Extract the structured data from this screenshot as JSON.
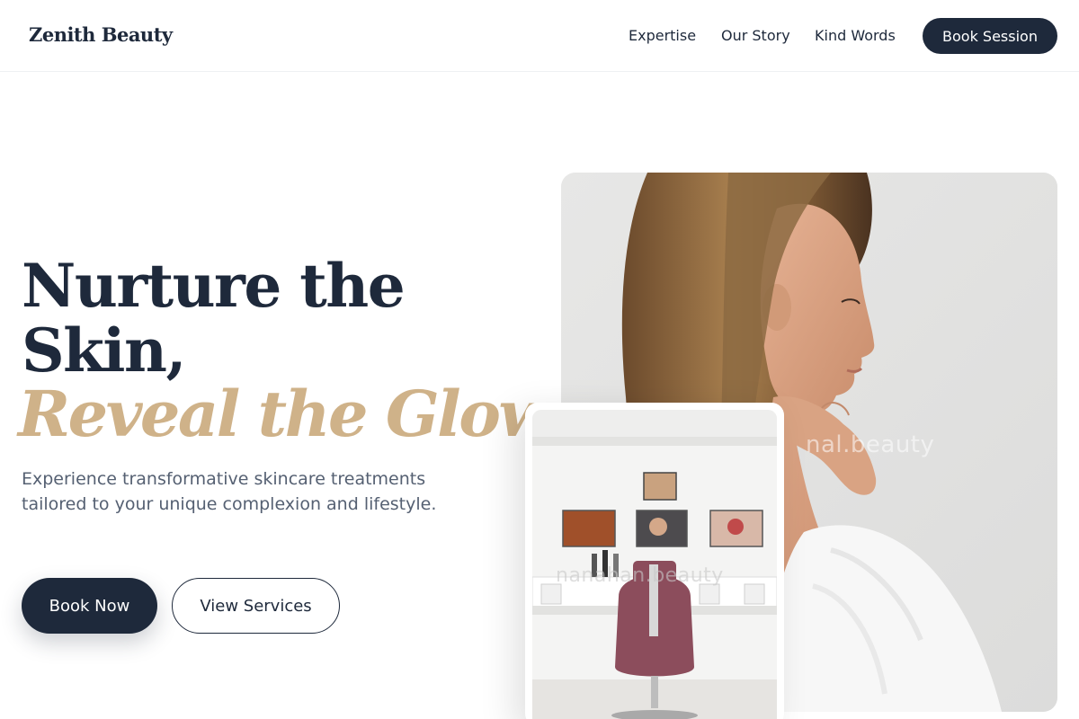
{
  "nav": {
    "brand": "Zenith Beauty",
    "links": [
      "Expertise",
      "Our Story",
      "Kind Words"
    ],
    "cta": "Book Session"
  },
  "hero": {
    "line1": "Nurture the",
    "line2": "Skin,",
    "line3": "Reveal the Glow.",
    "lead": "Experience transformative skincare treatments tailored to your unique complexion and lifestyle.",
    "primary": "Book Now",
    "secondary": "View Services",
    "watermark": "nal.beauty",
    "card_watermark": "nanahan.beauty"
  },
  "colors": {
    "navy": "#1e293b",
    "gold": "#cfb289",
    "muted": "#556072"
  }
}
